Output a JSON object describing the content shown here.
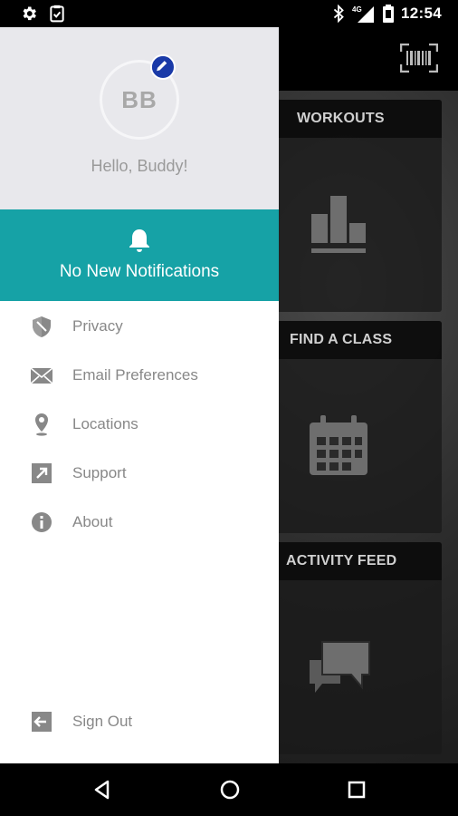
{
  "status_bar": {
    "left_icons": [
      "gear-icon",
      "clipboard-check-icon"
    ],
    "right_icons": [
      "bluetooth-icon",
      "signal-4g-icon",
      "battery-icon"
    ],
    "network_label": "4G",
    "time": "12:54"
  },
  "toolbar": {
    "barcode_icon": "barcode-scanner-icon"
  },
  "cards": [
    {
      "title": "WORKOUTS",
      "icon": "bar-chart-icon"
    },
    {
      "title": "FIND A CLASS",
      "icon": "calendar-icon"
    },
    {
      "title": "ACTIVITY FEED",
      "icon": "chat-bubbles-icon"
    }
  ],
  "drawer": {
    "avatar_initials": "BB",
    "edit_icon": "pencil-icon",
    "greeting": "Hello, Buddy!",
    "notifications": {
      "icon": "bell-icon",
      "text": "No New Notifications",
      "color": "#16a2a6"
    },
    "menu": [
      {
        "label": "Privacy",
        "icon": "shield-icon"
      },
      {
        "label": "Email Preferences",
        "icon": "envelope-icon"
      },
      {
        "label": "Locations",
        "icon": "location-pin-icon"
      },
      {
        "label": "Support",
        "icon": "external-link-icon"
      },
      {
        "label": "About",
        "icon": "info-icon"
      }
    ],
    "sign_out": {
      "label": "Sign Out",
      "icon": "exit-icon"
    }
  },
  "nav_bar": {
    "back": "back-triangle-icon",
    "home": "home-circle-icon",
    "recents": "recents-square-icon"
  }
}
